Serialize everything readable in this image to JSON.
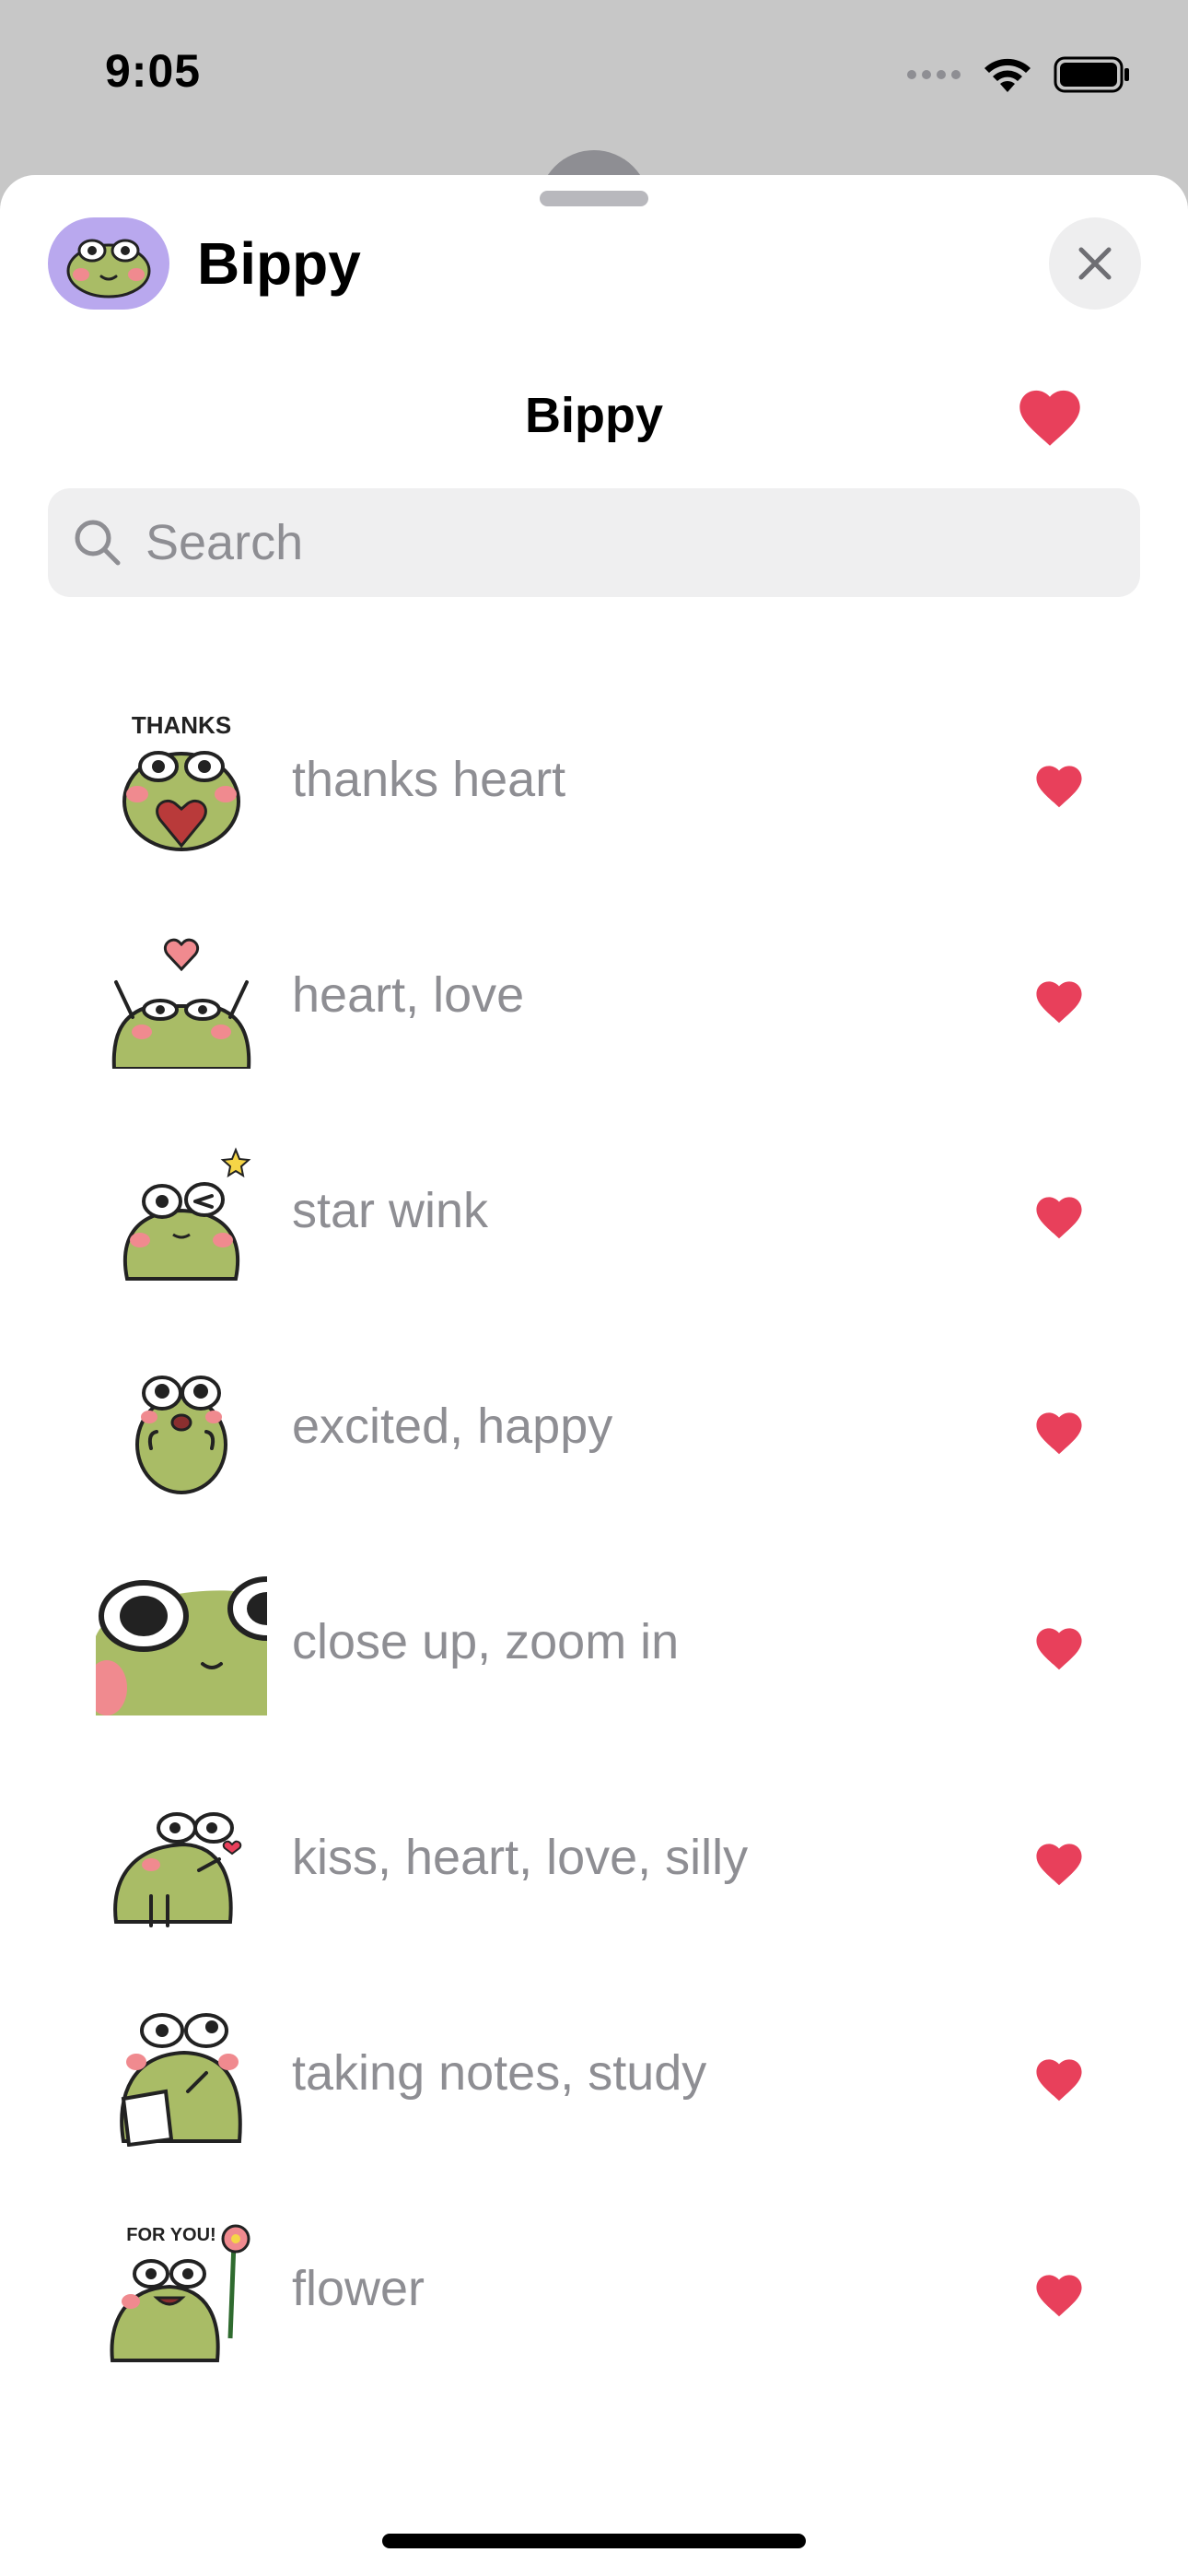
{
  "status_bar": {
    "time": "9:05"
  },
  "app": {
    "name": "Bippy",
    "avatar_icon": "frog-face-icon"
  },
  "pack": {
    "title": "Bippy",
    "favorited": true
  },
  "search": {
    "placeholder": "Search",
    "value": ""
  },
  "colors": {
    "accent_heart": "#e8405b",
    "frog_green": "#a9bc66",
    "cheek_pink": "#f08a8f",
    "avatar_bg": "#b9a8ee"
  },
  "stickers": [
    {
      "label": "thanks heart",
      "favorited": true,
      "icon": "frog-thanks-sticker",
      "text": "THANKS"
    },
    {
      "label": "heart, love",
      "favorited": true,
      "icon": "frog-heart-love-sticker"
    },
    {
      "label": "star wink",
      "favorited": true,
      "icon": "frog-star-wink-sticker"
    },
    {
      "label": "excited, happy",
      "favorited": true,
      "icon": "frog-excited-sticker"
    },
    {
      "label": "close up, zoom in",
      "favorited": true,
      "icon": "frog-close-up-sticker"
    },
    {
      "label": "kiss, heart, love, silly",
      "favorited": true,
      "icon": "frog-kiss-sticker"
    },
    {
      "label": "taking notes, study",
      "favorited": true,
      "icon": "frog-notes-sticker"
    },
    {
      "label": "flower",
      "favorited": true,
      "icon": "frog-flower-sticker",
      "text": "FOR YOU!"
    }
  ]
}
